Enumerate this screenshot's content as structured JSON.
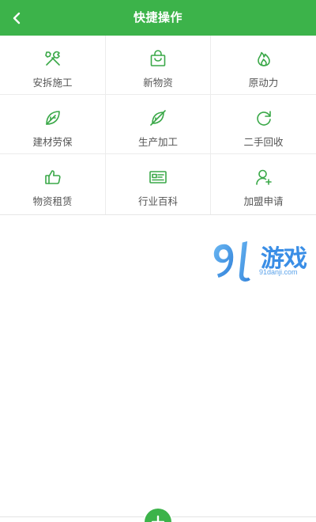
{
  "header": {
    "title": "快捷操作",
    "back_icon": "chevron-left-icon"
  },
  "grid": {
    "items": [
      {
        "label": "安拆施工",
        "icon": "tools-icon"
      },
      {
        "label": "新物资",
        "icon": "shopping-bag-icon"
      },
      {
        "label": "原动力",
        "icon": "flame-icon"
      },
      {
        "label": "建材劳保",
        "icon": "leaf-icon"
      },
      {
        "label": "生产加工",
        "icon": "leaf-slash-icon"
      },
      {
        "label": "二手回收",
        "icon": "refresh-icon"
      },
      {
        "label": "物资租赁",
        "icon": "thumbs-up-icon"
      },
      {
        "label": "行业百科",
        "icon": "id-card-icon"
      },
      {
        "label": "加盟申请",
        "icon": "add-user-icon"
      }
    ]
  },
  "watermark": {
    "brand": "游戏",
    "url": "91danji.com"
  },
  "colors": {
    "accent": "#3cb34a",
    "icon": "#3aa848",
    "label": "#555555",
    "watermark": "#3a8ee6"
  }
}
